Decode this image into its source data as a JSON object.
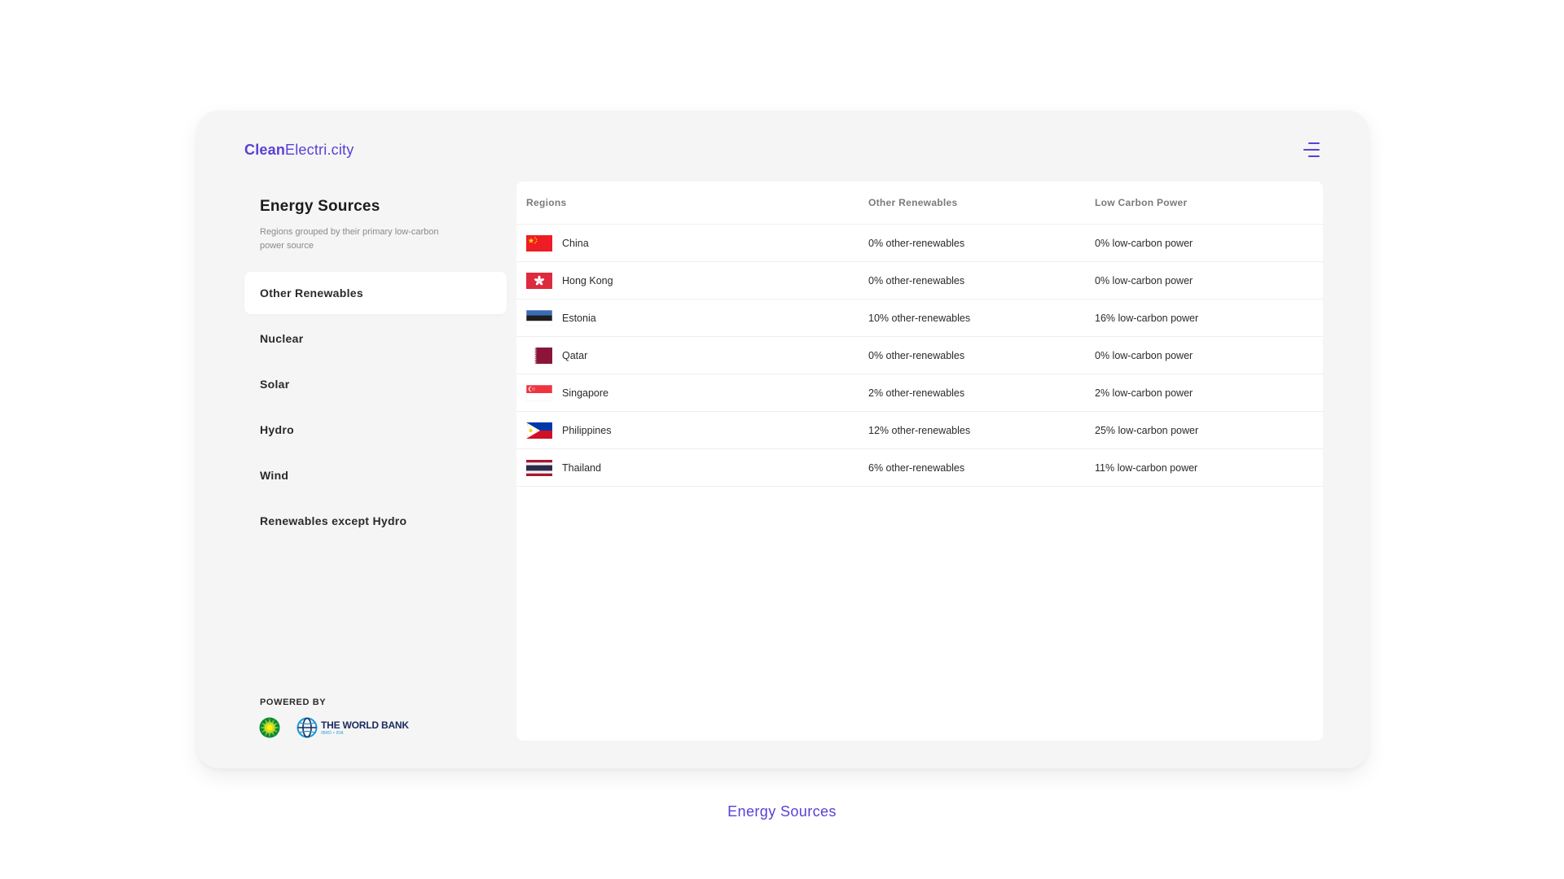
{
  "app": {
    "logo_bold": "Clean",
    "logo_light": "Electri.city"
  },
  "sidebar": {
    "title": "Energy Sources",
    "subtitle": "Regions grouped by their primary low-carbon power source",
    "items": [
      {
        "label": "Other Renewables",
        "active": true
      },
      {
        "label": "Nuclear",
        "active": false
      },
      {
        "label": "Solar",
        "active": false
      },
      {
        "label": "Hydro",
        "active": false
      },
      {
        "label": "Wind",
        "active": false
      },
      {
        "label": "Renewables except Hydro",
        "active": false
      }
    ],
    "powered_by": "POWERED BY",
    "world_bank_name": "THE WORLD BANK",
    "world_bank_sub": "IBRD • IDA"
  },
  "table": {
    "headers": {
      "region": "Regions",
      "other": "Other Renewables",
      "low": "Low Carbon Power"
    },
    "rows": [
      {
        "region": "China",
        "flag": "flag-china",
        "other": "0% other-renewables",
        "low": "0% low-carbon power"
      },
      {
        "region": "Hong Kong",
        "flag": "flag-hong-kong",
        "other": "0% other-renewables",
        "low": "0% low-carbon power"
      },
      {
        "region": "Estonia",
        "flag": "flag-estonia",
        "other": "10% other-renewables",
        "low": "16% low-carbon power"
      },
      {
        "region": "Qatar",
        "flag": "flag-qatar",
        "other": "0% other-renewables",
        "low": "0% low-carbon power"
      },
      {
        "region": "Singapore",
        "flag": "flag-singapore",
        "other": "2% other-renewables",
        "low": "2% low-carbon power"
      },
      {
        "region": "Philippines",
        "flag": "flag-philippines",
        "other": "12% other-renewables",
        "low": "25% low-carbon power"
      },
      {
        "region": "Thailand",
        "flag": "flag-thailand",
        "other": "6% other-renewables",
        "low": "11% low-carbon power"
      }
    ]
  },
  "caption": "Energy Sources",
  "colors": {
    "accent": "#5b3fd6",
    "card_bg": "#f5f5f5",
    "panel_bg": "#ffffff"
  }
}
